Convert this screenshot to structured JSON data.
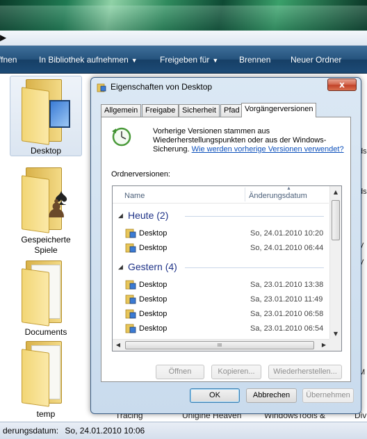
{
  "explorer": {
    "commands": [
      {
        "label": "ffnen",
        "dropdown": false
      },
      {
        "label": "In Bibliothek aufnehmen",
        "dropdown": true
      },
      {
        "label": "Freigeben für",
        "dropdown": true
      },
      {
        "label": "Brennen",
        "dropdown": false
      },
      {
        "label": "Neuer Ordner",
        "dropdown": false
      }
    ],
    "items": [
      {
        "label": "Desktop"
      },
      {
        "label": "Gespeicherte Spiele"
      },
      {
        "label": "Documents"
      },
      {
        "label": "temp"
      }
    ],
    "behind_labels": [
      "Tracing",
      "Unigine Heaven",
      "WindowsTools &",
      "Div"
    ],
    "right_edge_text": [
      "ds",
      "ds",
      "V",
      "V",
      "M"
    ],
    "status": {
      "label": "derungsdatum:",
      "value": "So, 24.01.2010 10:06"
    }
  },
  "dialog": {
    "title": "Eigenschaften von Desktop",
    "close_label": "x",
    "tabs": [
      "Allgemein",
      "Freigabe",
      "Sicherheit",
      "Pfad",
      "Vorgängerversionen"
    ],
    "active_tab": "Vorgängerversionen",
    "info_text": "Vorherige Versionen stammen aus Wiederherstellungspunkten oder aus der Windows-Sicherung.",
    "info_link": "Wie werden vorherige Versionen verwendet?",
    "section_label": "Ordnerversionen:",
    "columns": {
      "name": "Name",
      "date": "Änderungsdatum"
    },
    "groups": [
      {
        "title": "Heute (2)",
        "rows": [
          {
            "name": "Desktop",
            "date": "So, 24.01.2010 10:20"
          },
          {
            "name": "Desktop",
            "date": "So, 24.01.2010 06:44"
          }
        ]
      },
      {
        "title": "Gestern (4)",
        "rows": [
          {
            "name": "Desktop",
            "date": "Sa, 23.01.2010 13:38"
          },
          {
            "name": "Desktop",
            "date": "Sa, 23.01.2010 11:49"
          },
          {
            "name": "Desktop",
            "date": "Sa, 23.01.2010 06:58"
          },
          {
            "name": "Desktop",
            "date": "Sa, 23.01.2010 06:54"
          }
        ]
      }
    ],
    "action_buttons": {
      "open": "Öffnen",
      "copy": "Kopieren...",
      "restore": "Wiederherstellen..."
    },
    "footer_buttons": {
      "ok": "OK",
      "cancel": "Abbrechen",
      "apply": "Übernehmen"
    },
    "scroll_grip": "III"
  }
}
